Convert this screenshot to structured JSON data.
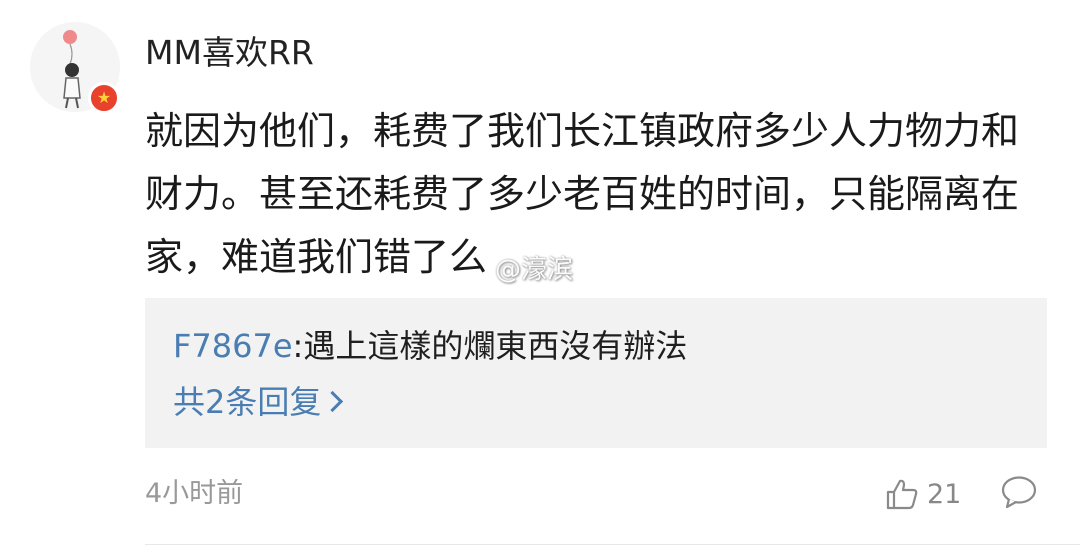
{
  "comment": {
    "username": "MM喜欢RR",
    "text": "就因为他们，耗费了我们长江镇政府多少人力物力和财力。甚至还耗费了多少老百姓的时间，只能隔离在家，难道我们错了么",
    "watermark": "@濠滨",
    "reply": {
      "author": "F7867e",
      "text": ":遇上這樣的爛東西沒有辦法",
      "more_label": "共2条回复"
    },
    "timestamp": "4小时前",
    "like_count": "21",
    "icons": {
      "avatar": "avatar-illustration-balloon",
      "badge": "verified-badge-icon",
      "like": "thumbs-up-icon",
      "comment": "comment-bubble-icon",
      "more": "chevron-right-icon"
    },
    "colors": {
      "link": "#4a7db1",
      "muted": "#999999",
      "reply_bg": "#f2f2f2",
      "badge": "#e8412c"
    }
  }
}
